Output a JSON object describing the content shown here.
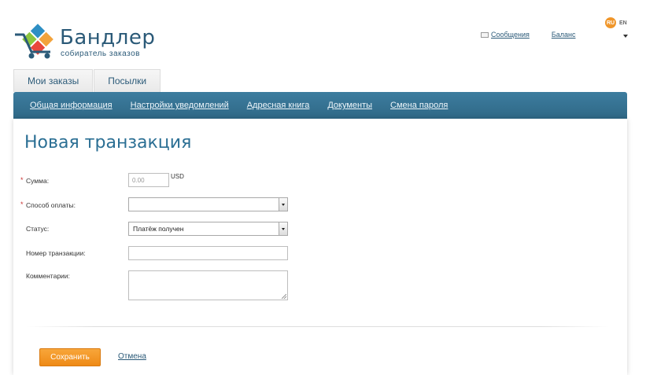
{
  "brand": {
    "name": "Бандлер",
    "tagline": "собиратель заказов"
  },
  "lang": {
    "active": "RU",
    "other": "EN"
  },
  "header": {
    "messages": "Сообщения",
    "balance": "Баланс"
  },
  "top_tabs": [
    {
      "label": "Мои заказы"
    },
    {
      "label": "Посылки"
    }
  ],
  "subnav": [
    {
      "label": "Общая информация"
    },
    {
      "label": "Настройки уведомлений"
    },
    {
      "label": "Адресная книга"
    },
    {
      "label": "Документы"
    },
    {
      "label": "Смена пароля"
    }
  ],
  "page": {
    "title": "Новая транзакция"
  },
  "form": {
    "amount": {
      "label": "Сумма:",
      "placeholder": "0.00",
      "currency": "USD",
      "required": true
    },
    "payment_method": {
      "label": "Способ оплаты:",
      "value": "",
      "required": true
    },
    "status": {
      "label": "Статус:",
      "value": "Платёж получен"
    },
    "transaction_number": {
      "label": "Номер транзакции:",
      "value": ""
    },
    "comments": {
      "label": "Комментарии:",
      "value": ""
    },
    "required_mark": "*"
  },
  "actions": {
    "save": "Сохранить",
    "cancel": "Отмена"
  },
  "colors": {
    "accent": "#2b6f94",
    "nav": "#3476a0",
    "button": "#f39a24",
    "required": "#c83232"
  }
}
